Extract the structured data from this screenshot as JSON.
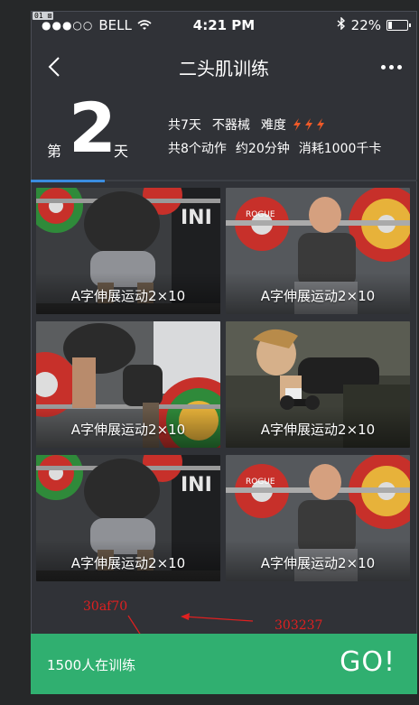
{
  "corner_tag": "01 ⊠",
  "status_bar": {
    "signal": "●●●○○",
    "carrier": "BELL",
    "time": "4:21 PM",
    "bluetooth": "✱",
    "battery": "22%",
    "battery_level": 0.22
  },
  "nav": {
    "title": "二头肌训练"
  },
  "day": {
    "prefix": "第",
    "number": "2",
    "suffix": "天"
  },
  "info": {
    "total_days": "共7天",
    "equipment": "不器械",
    "difficulty_label": "难度",
    "difficulty_level": 3,
    "actions": "共8个动作",
    "duration": "约20分钟",
    "calories": "消耗1000千卡"
  },
  "exercises": [
    {
      "label": "A字伸展运动2×10"
    },
    {
      "label": "A字伸展运动2×10"
    },
    {
      "label": "A字伸展运动2×10"
    },
    {
      "label": "A字伸展运动2×10"
    },
    {
      "label": "A字伸展运动2×10"
    },
    {
      "label": "A字伸展运动2×10"
    }
  ],
  "annotations": {
    "green_color": "30af70",
    "dark_color": "303237"
  },
  "bottom": {
    "count": "1500人在训练",
    "go": "GO!"
  },
  "colors": {
    "background": "#303237",
    "accent_green": "#30af70",
    "tab_blue": "#3a8de0",
    "bolt": "#f05a28"
  }
}
